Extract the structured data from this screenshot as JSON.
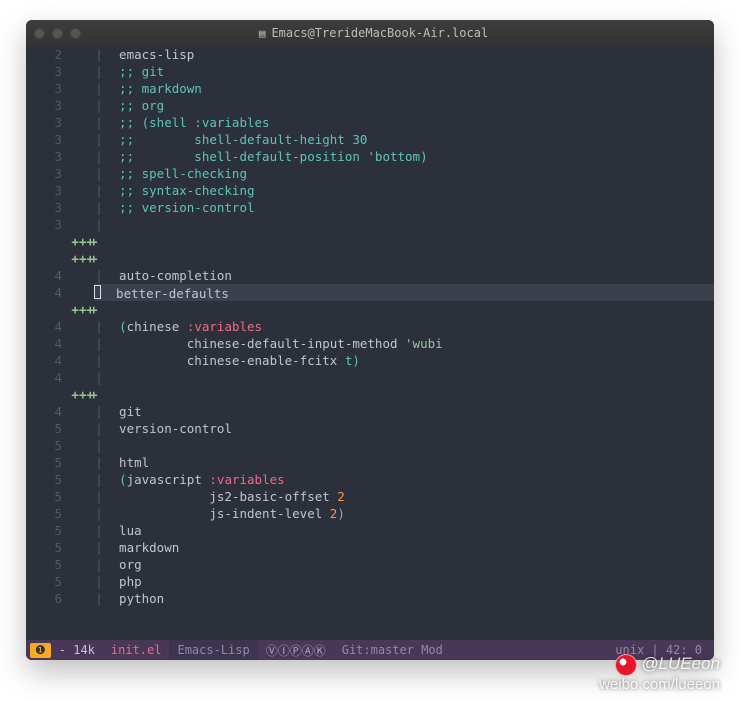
{
  "window": {
    "title": "Emacs@TrerideMacBook-Air.local"
  },
  "lines": [
    {
      "num": "2",
      "mark": "",
      "bar": "|",
      "segs": [
        {
          "cls": "tok-symbol",
          "t": "  emacs-lisp"
        }
      ]
    },
    {
      "num": "3",
      "mark": "",
      "bar": "|",
      "segs": [
        {
          "cls": "tok-comment",
          "t": "  ;; git"
        }
      ]
    },
    {
      "num": "3",
      "mark": "",
      "bar": "|",
      "segs": [
        {
          "cls": "tok-comment",
          "t": "  ;; markdown"
        }
      ]
    },
    {
      "num": "3",
      "mark": "",
      "bar": "|",
      "segs": [
        {
          "cls": "tok-comment",
          "t": "  ;; org"
        }
      ]
    },
    {
      "num": "3",
      "mark": "",
      "bar": "|",
      "segs": [
        {
          "cls": "tok-comment",
          "t": "  ;; (shell :variables"
        }
      ]
    },
    {
      "num": "3",
      "mark": "",
      "bar": "|",
      "segs": [
        {
          "cls": "tok-comment",
          "t": "  ;;        shell-default-height 30"
        }
      ]
    },
    {
      "num": "3",
      "mark": "",
      "bar": "|",
      "segs": [
        {
          "cls": "tok-comment",
          "t": "  ;;        shell-default-position 'bottom)"
        }
      ]
    },
    {
      "num": "3",
      "mark": "",
      "bar": "|",
      "segs": [
        {
          "cls": "tok-comment",
          "t": "  ;; spell-checking"
        }
      ]
    },
    {
      "num": "3",
      "mark": "",
      "bar": "|",
      "segs": [
        {
          "cls": "tok-comment",
          "t": "  ;; syntax-checking"
        }
      ]
    },
    {
      "num": "3",
      "mark": "",
      "bar": "|",
      "segs": [
        {
          "cls": "tok-comment",
          "t": "  ;; version-control"
        }
      ]
    },
    {
      "num": "3",
      "mark": "",
      "bar": "|",
      "segs": []
    },
    {
      "num": "",
      "mark": "+++",
      "bar": "",
      "plus": true,
      "segs": []
    },
    {
      "num": "",
      "mark": "+++",
      "bar": "",
      "plus": true,
      "segs": []
    },
    {
      "num": "4",
      "mark": "",
      "bar": "|",
      "segs": [
        {
          "cls": "tok-symbol",
          "t": "  auto-completion"
        }
      ]
    },
    {
      "num": "4",
      "mark": "",
      "bar": "|",
      "cursor": true,
      "hl": true,
      "segs": [
        {
          "cls": "tok-symbol",
          "t": "  better-defaults"
        }
      ]
    },
    {
      "num": "",
      "mark": "+++",
      "bar": "",
      "plus": true,
      "segs": []
    },
    {
      "num": "4",
      "mark": "",
      "bar": "|",
      "segs": [
        {
          "cls": "tok-symbol",
          "t": "  "
        },
        {
          "cls": "tok-paren",
          "t": "("
        },
        {
          "cls": "tok-symbol",
          "t": "chinese "
        },
        {
          "cls": "tok-keyvar",
          "t": ":variables"
        }
      ]
    },
    {
      "num": "4",
      "mark": "",
      "bar": "|",
      "segs": [
        {
          "cls": "tok-symbol",
          "t": "           chinese-default-input-method "
        },
        {
          "cls": "tok-string",
          "t": "'wubi"
        }
      ]
    },
    {
      "num": "4",
      "mark": "",
      "bar": "|",
      "segs": [
        {
          "cls": "tok-symbol",
          "t": "           chinese-enable-fcitx "
        },
        {
          "cls": "tok-keyword",
          "t": "t"
        },
        {
          "cls": "tok-paren",
          "t": ")"
        }
      ]
    },
    {
      "num": "4",
      "mark": "",
      "bar": "|",
      "segs": []
    },
    {
      "num": "",
      "mark": "+++",
      "bar": "",
      "plus": true,
      "segs": []
    },
    {
      "num": "4",
      "mark": "",
      "bar": "|",
      "segs": [
        {
          "cls": "tok-symbol",
          "t": "  git"
        }
      ]
    },
    {
      "num": "5",
      "mark": "",
      "bar": "|",
      "segs": [
        {
          "cls": "tok-symbol",
          "t": "  version-control"
        }
      ]
    },
    {
      "num": "5",
      "mark": "",
      "bar": "|",
      "segs": []
    },
    {
      "num": "5",
      "mark": "",
      "bar": "|",
      "segs": [
        {
          "cls": "tok-symbol",
          "t": "  html"
        }
      ]
    },
    {
      "num": "5",
      "mark": "",
      "bar": "|",
      "segs": [
        {
          "cls": "tok-symbol",
          "t": "  "
        },
        {
          "cls": "tok-paren",
          "t": "("
        },
        {
          "cls": "tok-symbol",
          "t": "javascript "
        },
        {
          "cls": "tok-keyvar",
          "t": ":variables"
        }
      ]
    },
    {
      "num": "5",
      "mark": "",
      "bar": "|",
      "segs": [
        {
          "cls": "tok-symbol",
          "t": "              js2-basic-offset "
        },
        {
          "cls": "tok-number",
          "t": "2"
        }
      ]
    },
    {
      "num": "5",
      "mark": "",
      "bar": "|",
      "segs": [
        {
          "cls": "tok-symbol",
          "t": "              js-indent-level "
        },
        {
          "cls": "tok-number",
          "t": "2"
        },
        {
          "cls": "tok-paren",
          "t": ")"
        }
      ]
    },
    {
      "num": "5",
      "mark": "",
      "bar": "|",
      "segs": [
        {
          "cls": "tok-symbol",
          "t": "  lua"
        }
      ]
    },
    {
      "num": "5",
      "mark": "",
      "bar": "|",
      "segs": [
        {
          "cls": "tok-symbol",
          "t": "  markdown"
        }
      ]
    },
    {
      "num": "5",
      "mark": "",
      "bar": "|",
      "segs": [
        {
          "cls": "tok-symbol",
          "t": "  org"
        }
      ]
    },
    {
      "num": "5",
      "mark": "",
      "bar": "|",
      "segs": [
        {
          "cls": "tok-symbol",
          "t": "  php"
        }
      ]
    },
    {
      "num": "6",
      "mark": "",
      "bar": "|",
      "segs": [
        {
          "cls": "tok-symbol",
          "t": "  python"
        }
      ]
    }
  ],
  "modeline": {
    "warn": "❶",
    "size": "- 14k",
    "file": "init.el",
    "mode": "Emacs-Lisp",
    "icons": "ⓋⒾⓅⒶⓀ",
    "git": "Git:master Mod",
    "right": "unix | 42: 0"
  },
  "watermark": {
    "handle": "@LUEeon",
    "url": "weibo.com/lueeon"
  }
}
